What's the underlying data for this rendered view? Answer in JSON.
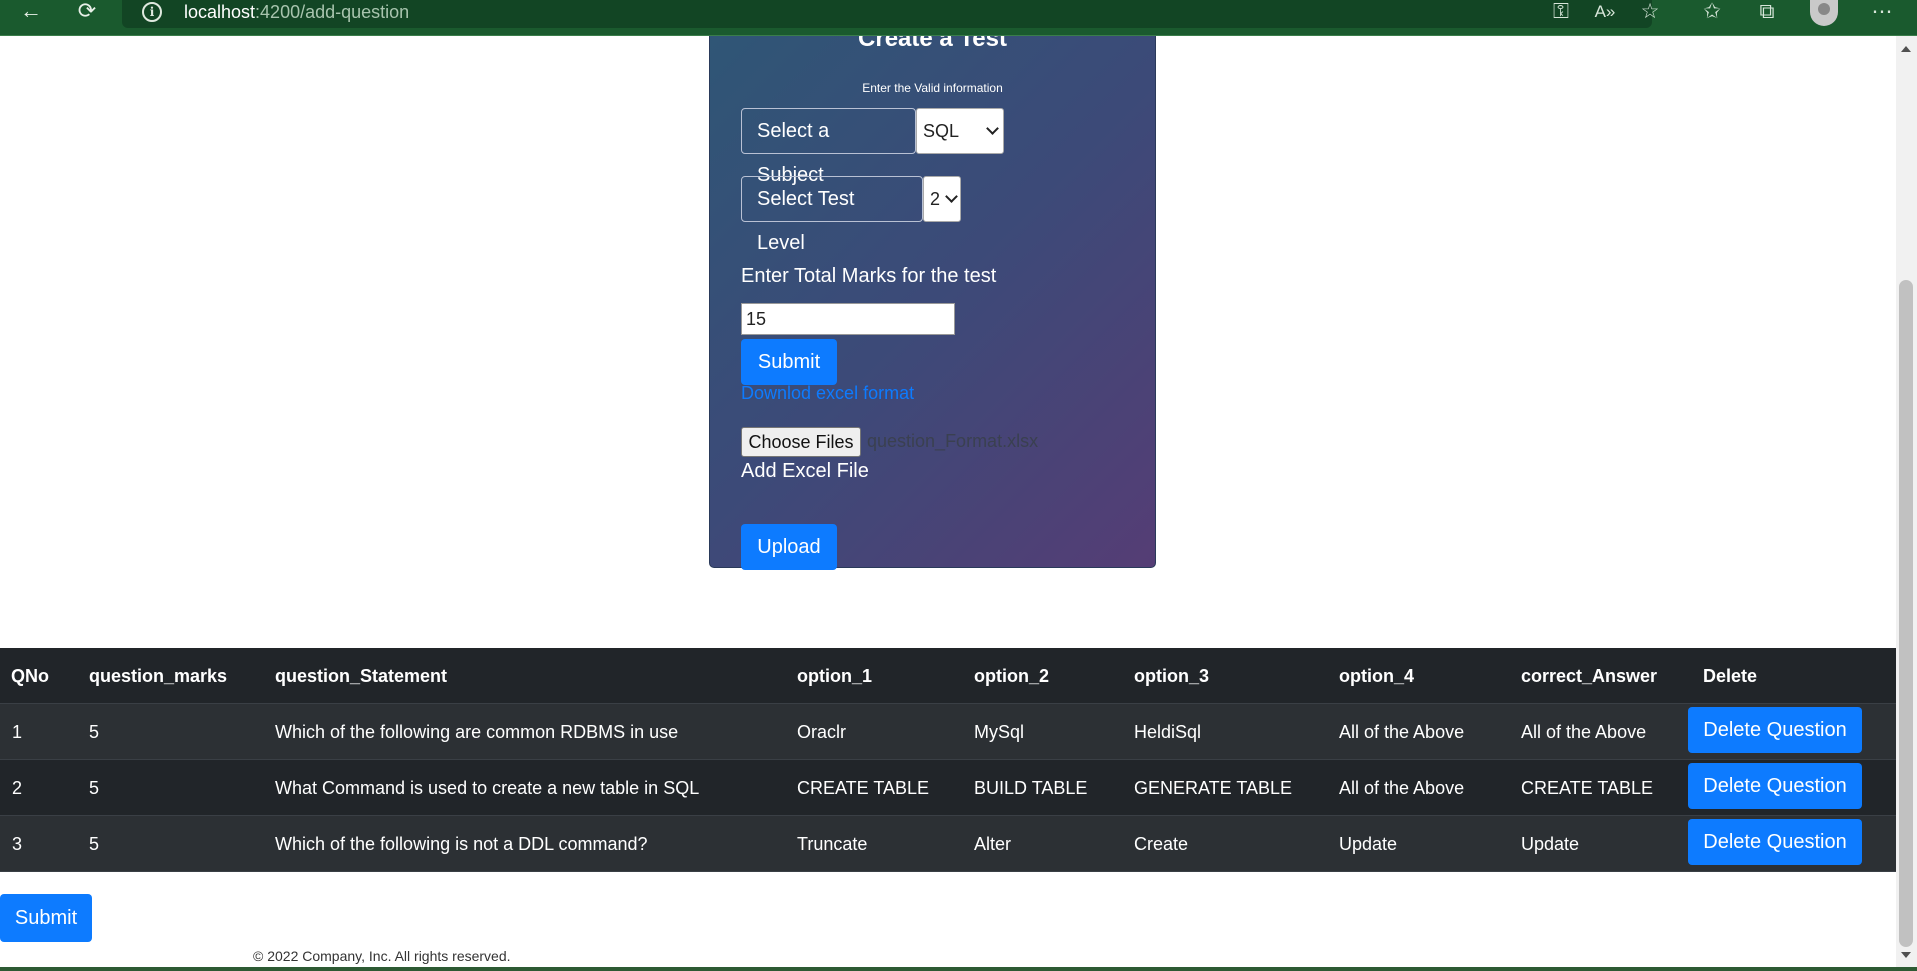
{
  "browser": {
    "url_host": "localhost",
    "url_path": ":4200/add-question",
    "back_glyph": "←",
    "refresh_glyph": "⟳",
    "info_glyph": "i",
    "icons": [
      "key-icon",
      "read-aloud-icon",
      "favorite-add-icon",
      "favorites-icon",
      "collections-icon",
      "profile-icon",
      "more-icon"
    ]
  },
  "form": {
    "title": "Create a Test",
    "subtitle": "Enter the Valid information",
    "subject_label": "Select a Subject",
    "subject_value": "SQL",
    "level_label": "Select Test Level",
    "level_value": "2",
    "marks_label": "Enter Total Marks for the test",
    "marks_value": "15",
    "submit_label": "Submit",
    "download_link": "Downlod excel format",
    "choose_files_label": "Choose Files",
    "chosen_file": "question_Format.xlsx",
    "add_excel_label": "Add Excel File",
    "upload_label": "Upload"
  },
  "table": {
    "headers": [
      "QNo",
      "question_marks",
      "question_Statement",
      "option_1",
      "option_2",
      "option_3",
      "option_4",
      "correct_Answer",
      "Delete"
    ],
    "rows": [
      [
        "1",
        "5",
        "Which of the following are common RDBMS in use",
        "Oraclr",
        "MySql",
        "HeldiSql",
        "All of the Above",
        "All of the Above"
      ],
      [
        "2",
        "5",
        "What Command is used to create a new table in SQL",
        "CREATE TABLE",
        "BUILD TABLE",
        "GENERATE TABLE",
        "All of the Above",
        "CREATE TABLE"
      ],
      [
        "3",
        "5",
        "Which of the following is not a DDL command?",
        "Truncate",
        "Alter",
        "Create",
        "Update",
        "Update"
      ]
    ],
    "delete_label": "Delete Question"
  },
  "page": {
    "submit_label": "Submit",
    "footer": "© 2022 Company, Inc. All rights reserved."
  },
  "colors": {
    "primary": "#0d7bff",
    "table_bg": "#212529",
    "browser_bar": "#1a5a2e"
  }
}
